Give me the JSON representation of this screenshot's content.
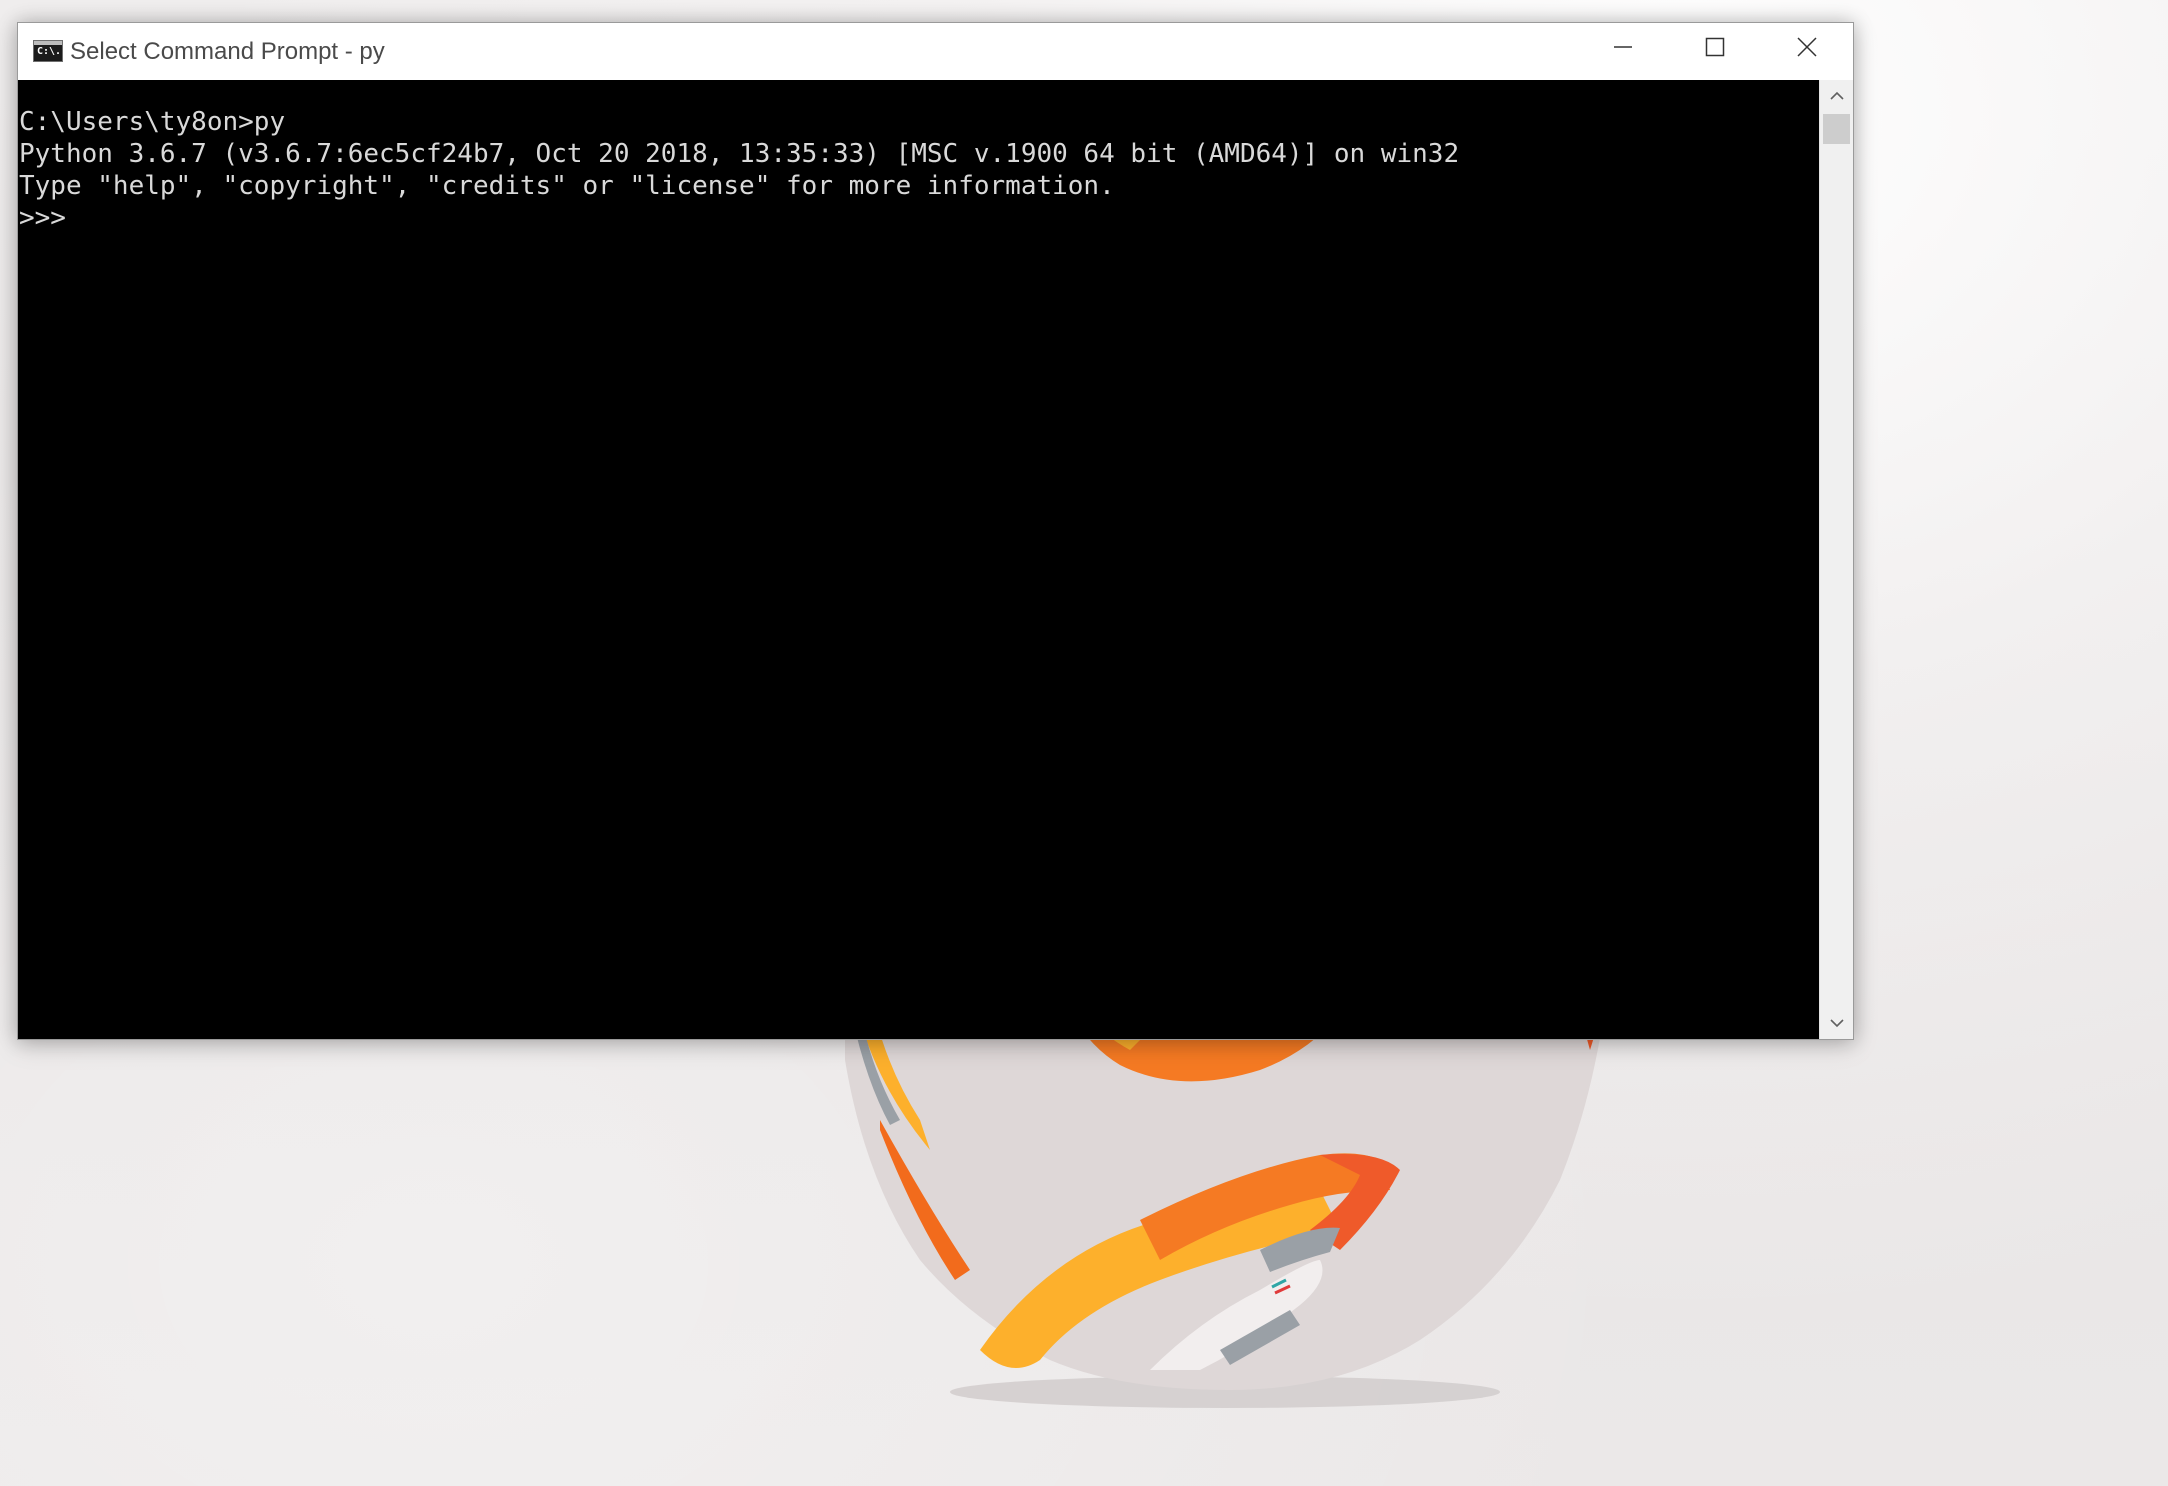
{
  "window": {
    "title": "Select Command Prompt - py",
    "icon": "cmd-icon",
    "icon_text": "C:\\."
  },
  "controls": {
    "minimize_icon": "minimize-icon",
    "maximize_icon": "maximize-icon",
    "close_icon": "close-icon"
  },
  "console": {
    "background": "#000000",
    "foreground": "#d9d9d9",
    "lines": [
      "C:\\Users\\ty8on>py",
      "Python 3.6.7 (v3.6.7:6ec5cf24b7, Oct 20 2018, 13:35:33) [MSC v.1900 64 bit (AMD64)] on win32",
      "Type \"help\", \"copyright\", \"credits\" or \"license\" for more information.",
      ">>>"
    ]
  },
  "scrollbar": {
    "up_icon": "scroll-up-arrow-icon",
    "down_icon": "scroll-down-arrow-icon"
  },
  "colors": {
    "accent_orange": "#f97a1f",
    "accent_yellow": "#fdbb2d",
    "desktop_bg": "#e9e6e6"
  }
}
